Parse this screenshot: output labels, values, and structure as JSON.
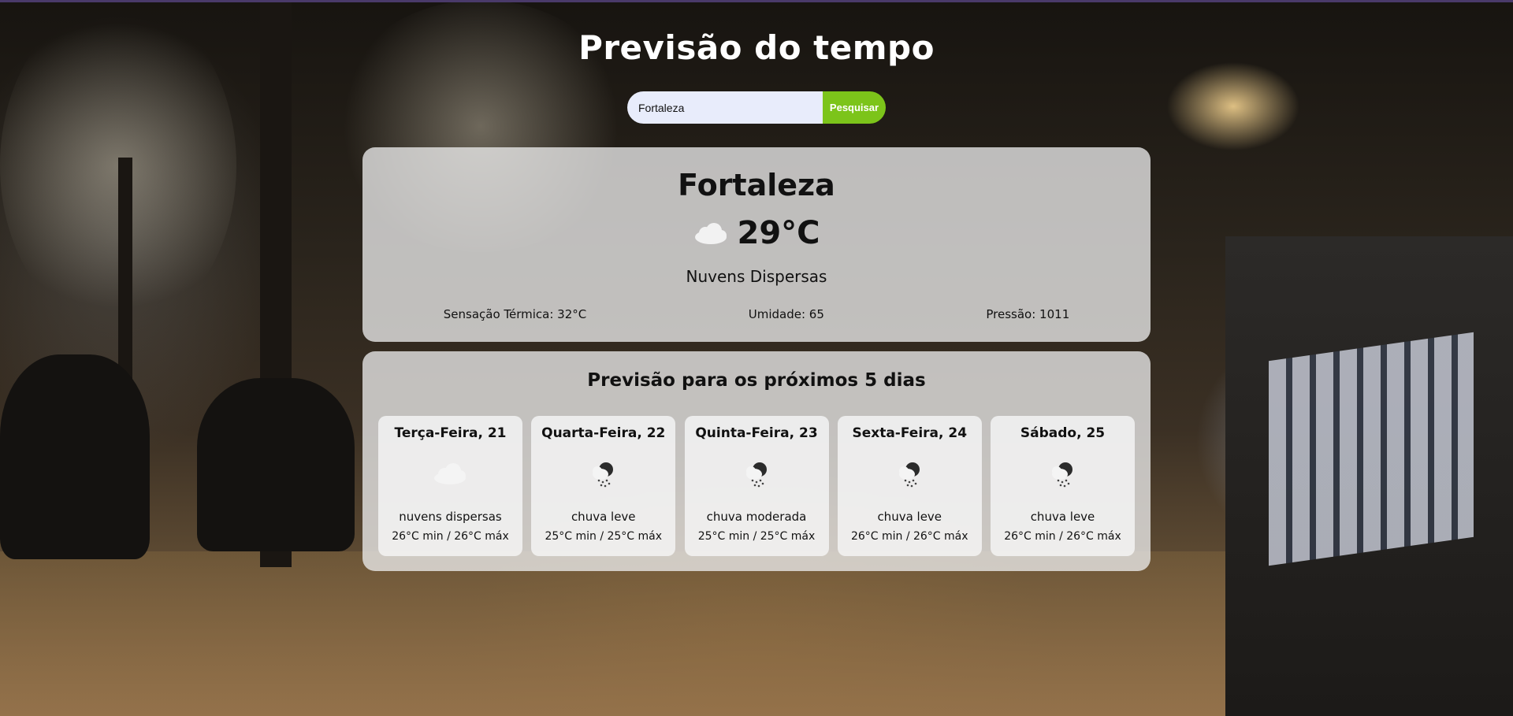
{
  "app": {
    "title": "Previsão do tempo"
  },
  "search": {
    "value": "Fortaleza",
    "button_label": "Pesquisar"
  },
  "current": {
    "city": "Fortaleza",
    "icon": "cloud-icon",
    "temperature": "29°C",
    "description": "Nuvens Dispersas",
    "feels_like": "Sensação Térmica: 32°C",
    "humidity": "Umidade: 65",
    "pressure": "Pressão: 1011"
  },
  "forecast": {
    "title": "Previsão para os próximos 5 dias",
    "days": [
      {
        "name": "Terça-Feira, 21",
        "icon": "cloud-icon",
        "description": "nuvens dispersas",
        "range": "26°C min / 26°C máx"
      },
      {
        "name": "Quarta-Feira, 22",
        "icon": "rain-cloud-icon",
        "description": "chuva leve",
        "range": "25°C min / 25°C máx"
      },
      {
        "name": "Quinta-Feira, 23",
        "icon": "rain-cloud-icon",
        "description": "chuva moderada",
        "range": "25°C min / 25°C máx"
      },
      {
        "name": "Sexta-Feira, 24",
        "icon": "rain-cloud-icon",
        "description": "chuva leve",
        "range": "26°C min / 26°C máx"
      },
      {
        "name": "Sábado, 25",
        "icon": "rain-cloud-icon",
        "description": "chuva leve",
        "range": "26°C min / 26°C máx"
      }
    ]
  },
  "colors": {
    "search_button": "#7cc41a",
    "search_input_bg": "#e8ecfb",
    "title_text": "#ffffff",
    "card_bg": "rgba(235,235,235,0.78)"
  }
}
